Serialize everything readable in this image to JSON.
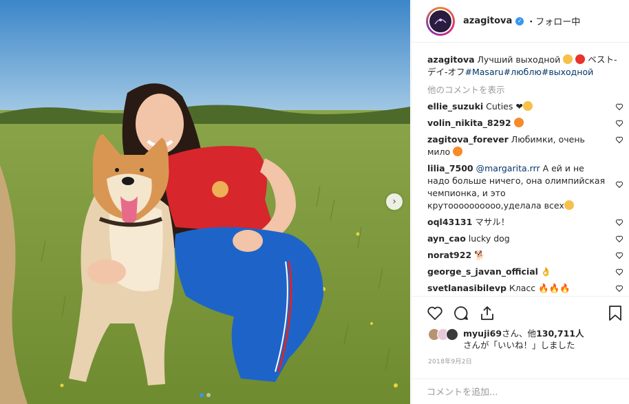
{
  "post": {
    "username": "azagitova",
    "follow_status": "・フォロー中",
    "caption_user": "azagitova",
    "caption_text": "Лучший выходной",
    "caption_text_2": "ベスト-デイ-オフ",
    "hashtags": [
      "#Masaru",
      "#люблю",
      "#выходной"
    ],
    "view_more": "他のコメントを表示"
  },
  "comments": [
    {
      "user": "ellie_suzuki",
      "text": "Cuties ❤",
      "emoji_color": "#f7c04a"
    },
    {
      "user": "volin_nikita_8292",
      "text": "",
      "emoji_color": "#f78a2a"
    },
    {
      "user": "zagitova_forever",
      "text": "Любимки, очень мило",
      "emoji_color": "#f78a2a"
    },
    {
      "user": "lilia_7500",
      "mention": "@margarita.rrr",
      "text": "А ей и не надо больше ничего, она олимпийская чемпионка, и это крутоооооооооо,уделала всех",
      "emoji_color": "#f7c04a"
    },
    {
      "user": "oql43131",
      "text": "マサル！",
      "emoji_color": ""
    },
    {
      "user": "ayn_cao",
      "text": "lucky dog",
      "emoji_color": ""
    },
    {
      "user": "norat922",
      "text": "🐕",
      "emoji_color": ""
    },
    {
      "user": "george_s_javan_official",
      "text": "👌",
      "emoji_color": ""
    },
    {
      "user": "svetlanasibilevp",
      "text": "Класс 🔥🔥🔥",
      "emoji_color": ""
    }
  ],
  "likes": {
    "liker": "myuji69",
    "text_1": "さん、他",
    "count": "130,711人",
    "text_2": "さんが「いいね！」しました"
  },
  "date": "2018年9月2日",
  "add_comment_placeholder": "コメントを追加...",
  "colors": {
    "link": "#003569",
    "accent": "#3897f0",
    "muted": "#999999"
  },
  "icons": [
    "heart-icon",
    "comment-icon",
    "share-icon",
    "bookmark-icon",
    "verified-icon",
    "chevron-right-icon"
  ]
}
